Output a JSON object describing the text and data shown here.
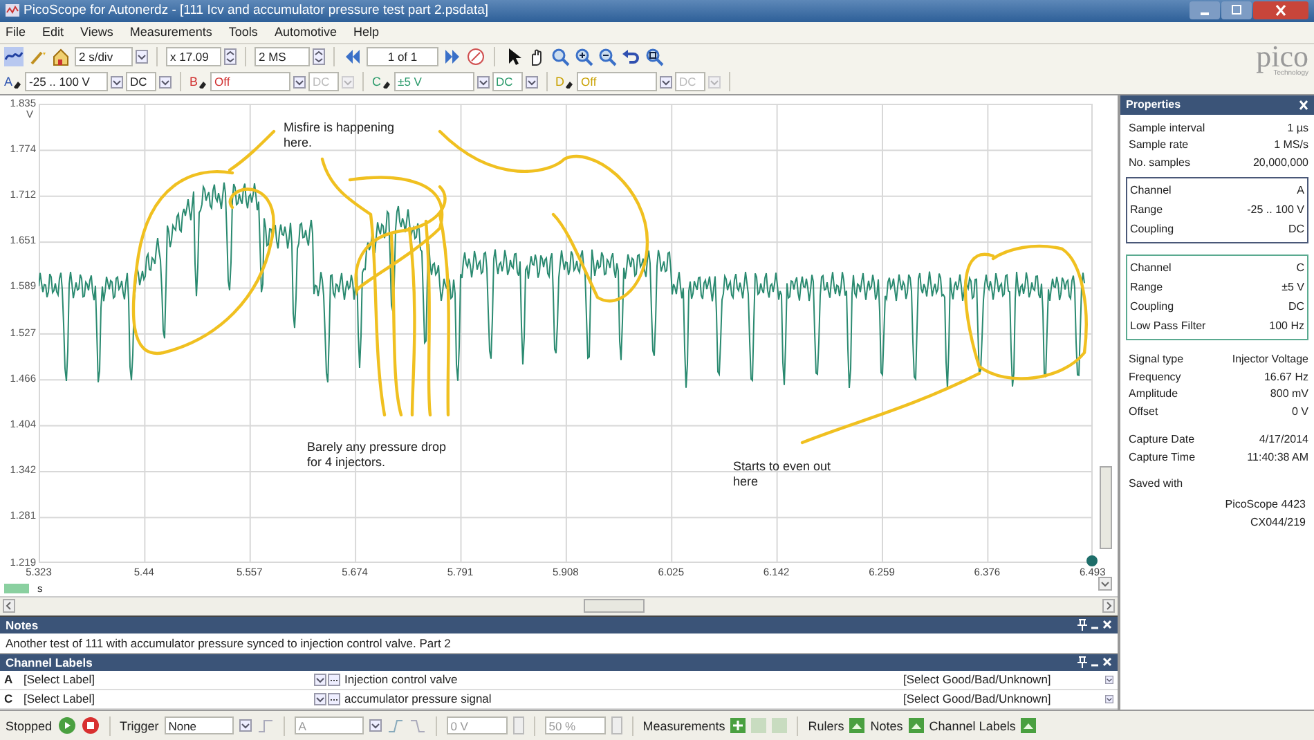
{
  "window": {
    "title": "PicoScope for Autonerdz - [111 Icv and accumulator pressure test part 2.psdata]"
  },
  "menu": [
    "File",
    "Edit",
    "Views",
    "Measurements",
    "Tools",
    "Automotive",
    "Help"
  ],
  "toolbar": {
    "timebase": "2 s/div",
    "zoom": "x 17.09",
    "samples": "2 MS",
    "buffer": "1 of 1"
  },
  "logo": {
    "name": "pico",
    "tagline": "Technology"
  },
  "channels_bar": [
    {
      "name": "A",
      "range": "-25 .. 100 V",
      "coupling": "DC",
      "enabled": true,
      "color": "#2f55b0"
    },
    {
      "name": "B",
      "range": "Off",
      "coupling": "DC",
      "enabled": false,
      "color": "#d03030"
    },
    {
      "name": "C",
      "range": "±5 V",
      "coupling": "DC",
      "enabled": true,
      "color": "#2a9a6a"
    },
    {
      "name": "D",
      "range": "Off",
      "coupling": "DC",
      "enabled": false,
      "color": "#c8a000"
    }
  ],
  "scope": {
    "y_unit": "V",
    "y_ticks": [
      "1.835",
      "1.774",
      "1.712",
      "1.651",
      "1.589",
      "1.527",
      "1.466",
      "1.404",
      "1.342",
      "1.281",
      "1.219"
    ],
    "x_unit": "s",
    "x_ticks": [
      "5.323",
      "5.44",
      "5.557",
      "5.674",
      "5.791",
      "5.908",
      "6.025",
      "6.142",
      "6.259",
      "6.376",
      "6.493"
    ],
    "annotations": [
      "Misfire is happening here.",
      "Barely any pressure drop for 4 injectors.",
      "Starts to even out here"
    ]
  },
  "properties": {
    "title": "Properties",
    "general": [
      {
        "label": "Sample interval",
        "value": "1 µs"
      },
      {
        "label": "Sample rate",
        "value": "1 MS/s"
      },
      {
        "label": "No. samples",
        "value": "20,000,000"
      }
    ],
    "channel_groups": [
      {
        "color": "#4a5878",
        "rows": [
          {
            "label": "Channel",
            "value": "A"
          },
          {
            "label": "Range",
            "value": "-25 .. 100 V"
          },
          {
            "label": "Coupling",
            "value": "DC"
          }
        ]
      },
      {
        "color": "#5aaa90",
        "rows": [
          {
            "label": "Channel",
            "value": "C"
          },
          {
            "label": "Range",
            "value": "±5 V"
          },
          {
            "label": "Coupling",
            "value": "DC"
          },
          {
            "label": "Low Pass Filter",
            "value": "100 Hz"
          }
        ]
      }
    ],
    "signal": [
      {
        "label": "Signal type",
        "value": "Injector Voltage"
      },
      {
        "label": "Frequency",
        "value": "16.67 Hz"
      },
      {
        "label": "Amplitude",
        "value": "800 mV"
      },
      {
        "label": "Offset",
        "value": "0 V"
      }
    ],
    "capture": [
      {
        "label": "Capture Date",
        "value": "4/17/2014"
      },
      {
        "label": "Capture Time",
        "value": "11:40:38 AM"
      }
    ],
    "saved_with": {
      "label": "Saved with",
      "lines": [
        "PicoScope 4423",
        "CX044/219"
      ]
    }
  },
  "notes": {
    "title": "Notes",
    "text": "Another test of 111 with accumulator pressure synced to injection control valve. Part 2"
  },
  "channel_labels": {
    "title": "Channel Labels",
    "rows": [
      {
        "channel": "A",
        "label": "[Select Label]",
        "description": "Injection control valve",
        "rating": "[Select Good/Bad/Unknown]"
      },
      {
        "channel": "C",
        "label": "[Select Label]",
        "description": "accumulator pressure signal",
        "rating": "[Select Good/Bad/Unknown]"
      }
    ]
  },
  "status_bar": {
    "state": "Stopped",
    "trigger_label": "Trigger",
    "trigger_mode": "None",
    "trigger_channel": "A",
    "trigger_level": "0 V",
    "trigger_percent": "50 %",
    "toggles": [
      "Measurements",
      "Rulers",
      "Notes",
      "Channel Labels"
    ]
  }
}
